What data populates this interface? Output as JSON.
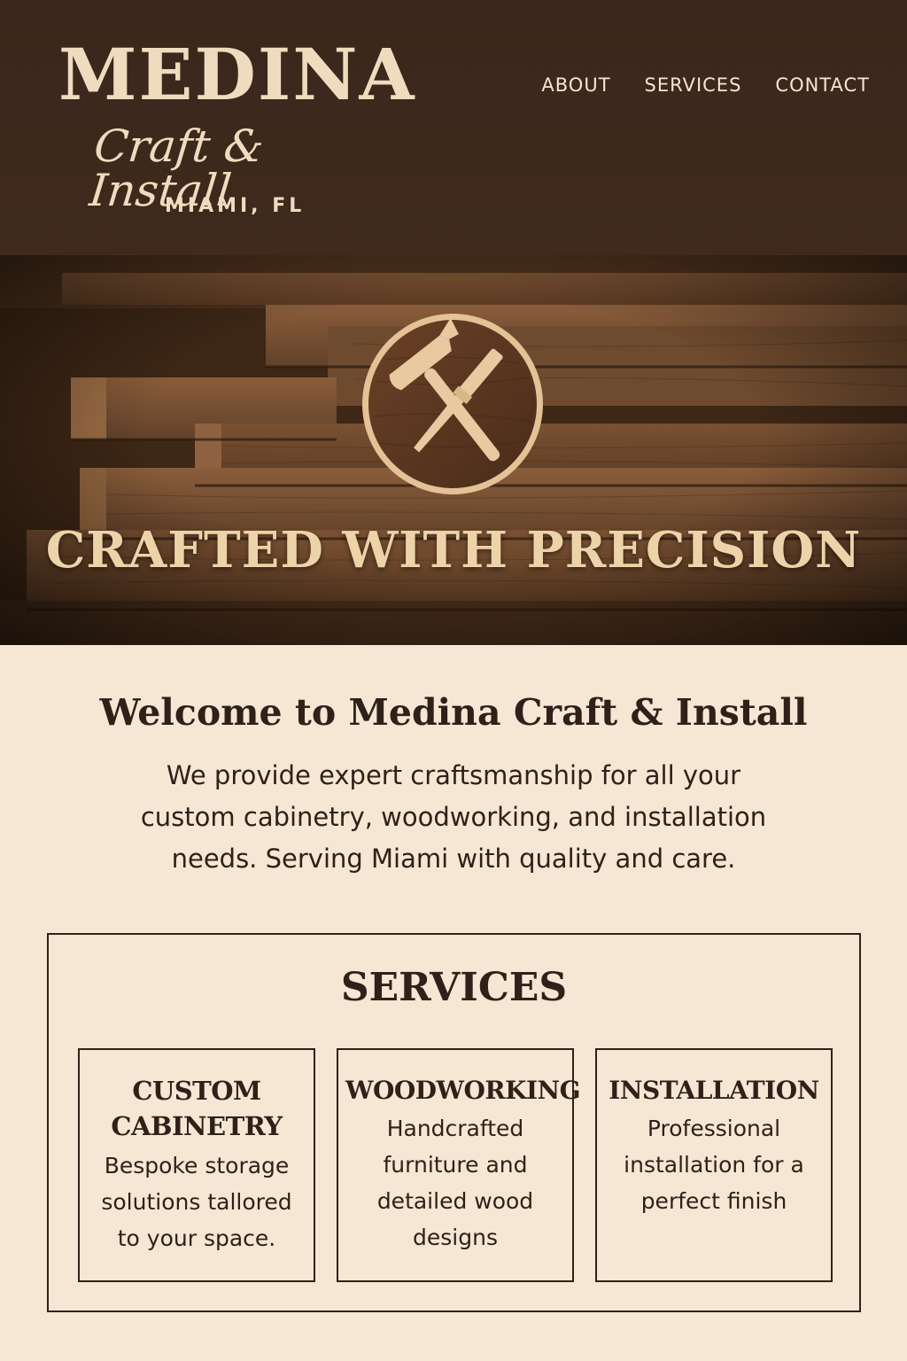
{
  "brand": {
    "name": "MEDINA",
    "tagline": "Craft & Install",
    "location": "MIAMI, FL"
  },
  "nav": {
    "items": [
      "ABOUT",
      "SERVICES",
      "CONTACT"
    ]
  },
  "hero": {
    "emblem_icon": "hammer-and-chisel-icon",
    "title": "CRAFTED WITH PRECISION"
  },
  "welcome": {
    "title": "Welcome to Medina Craft & Install",
    "text": "We provide expert craftsmanship for all your custom cabinetry, woodworking, and installation needs. Serving Miami with quality and care."
  },
  "services": {
    "title": "SERVICES",
    "cards": [
      {
        "title": "CUSTOM CABINETRY",
        "description": "Bespoke storage solutions tallored to your space."
      },
      {
        "title": "WOODWORKING",
        "description": "Handcrafted furniture and detailed wood designs"
      },
      {
        "title": "INSTALLATION",
        "description": "Professional installation for a perfect finish"
      }
    ]
  },
  "colors": {
    "header_bg": "#3f2a1d",
    "cream": "#f6e7d4",
    "accent_tan": "#edd3a8",
    "text_dark": "#2e2119"
  }
}
